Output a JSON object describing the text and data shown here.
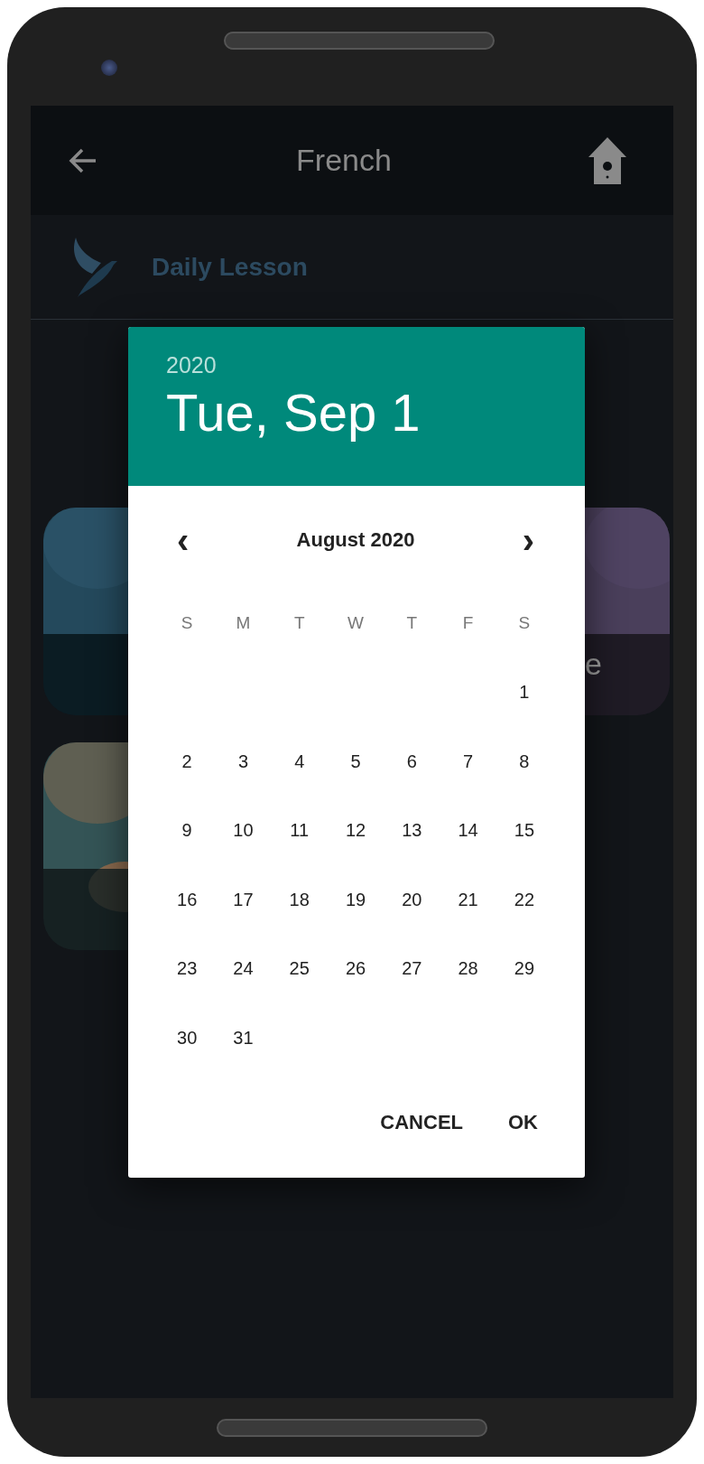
{
  "app_bar": {
    "title": "French"
  },
  "lesson_row": {
    "label": "Daily Lesson"
  },
  "cards": [
    {
      "kind": "picture"
    },
    {
      "kind": "picture",
      "label": "e"
    },
    {
      "kind": "picture"
    }
  ],
  "date_picker": {
    "year": "2020",
    "date": "Tue, Sep 1",
    "month": "August 2020",
    "prev": "‹",
    "next": "›",
    "weekdays": [
      "S",
      "M",
      "T",
      "W",
      "T",
      "F",
      "S"
    ],
    "weeks": [
      [
        {
          "kind": "blank"
        },
        {
          "kind": "blank"
        },
        {
          "kind": "blank"
        },
        {
          "kind": "blank"
        },
        {
          "kind": "blank"
        },
        {
          "kind": "blank"
        },
        {
          "kind": "day",
          "text": "1"
        }
      ],
      [
        {
          "kind": "day",
          "text": "2"
        },
        {
          "kind": "day",
          "text": "3"
        },
        {
          "kind": "day",
          "text": "4"
        },
        {
          "kind": "day",
          "text": "5"
        },
        {
          "kind": "day",
          "text": "6"
        },
        {
          "kind": "day",
          "text": "7"
        },
        {
          "kind": "day",
          "text": "8"
        }
      ],
      [
        {
          "kind": "day",
          "text": "9"
        },
        {
          "kind": "day",
          "text": "10"
        },
        {
          "kind": "day",
          "text": "11"
        },
        {
          "kind": "day",
          "text": "12"
        },
        {
          "kind": "day",
          "text": "13"
        },
        {
          "kind": "day",
          "text": "14"
        },
        {
          "kind": "day",
          "text": "15"
        }
      ],
      [
        {
          "kind": "day",
          "text": "16"
        },
        {
          "kind": "day",
          "text": "17"
        },
        {
          "kind": "day",
          "text": "18"
        },
        {
          "kind": "day",
          "text": "19"
        },
        {
          "kind": "day",
          "text": "20"
        },
        {
          "kind": "day",
          "text": "21"
        },
        {
          "kind": "day",
          "text": "22"
        }
      ],
      [
        {
          "kind": "day",
          "text": "23"
        },
        {
          "kind": "day",
          "text": "24"
        },
        {
          "kind": "day",
          "text": "25"
        },
        {
          "kind": "day",
          "text": "26"
        },
        {
          "kind": "day",
          "text": "27"
        },
        {
          "kind": "day",
          "text": "28"
        },
        {
          "kind": "day",
          "text": "29"
        }
      ],
      [
        {
          "kind": "day",
          "text": "30"
        },
        {
          "kind": "day",
          "text": "31"
        },
        {
          "kind": "blank"
        },
        {
          "kind": "blank"
        },
        {
          "kind": "blank"
        },
        {
          "kind": "blank"
        },
        {
          "kind": "blank"
        }
      ]
    ],
    "buttons": [
      "CANCEL",
      "OK"
    ]
  }
}
